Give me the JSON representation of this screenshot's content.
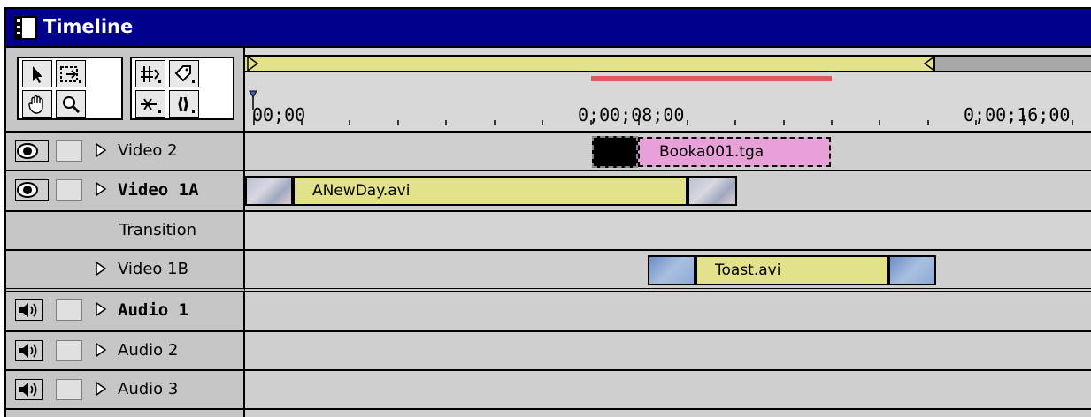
{
  "window": {
    "title": "Timeline"
  },
  "toolbox": {
    "tools": [
      "selection-tool",
      "range-select-tool",
      "track-select-tool",
      "marker-tool",
      "hand-tool",
      "zoom-tool",
      "razor-tool",
      "in-out-tool"
    ]
  },
  "ruler": {
    "timecodes": [
      "00;00",
      "0;00;08;00",
      "0;00;16;00"
    ]
  },
  "tracks": [
    {
      "name": "Video 2",
      "bold": false
    },
    {
      "name": "Video 1A",
      "bold": true
    },
    {
      "name": "Transition",
      "bold": false
    },
    {
      "name": "Video 1B",
      "bold": false
    },
    {
      "name": "Audio 1",
      "bold": true
    },
    {
      "name": "Audio 2",
      "bold": false
    },
    {
      "name": "Audio 3",
      "bold": false
    }
  ],
  "clips": {
    "video2": "Booka001.tga",
    "video1a": "ANewDay.avi",
    "video1b": "Toast.avi"
  },
  "colors": {
    "title_bar": "#00008c",
    "clip_yellow": "#e2e28a",
    "clip_pink": "#e8a0d8",
    "preview_red": "#d85c5c"
  }
}
